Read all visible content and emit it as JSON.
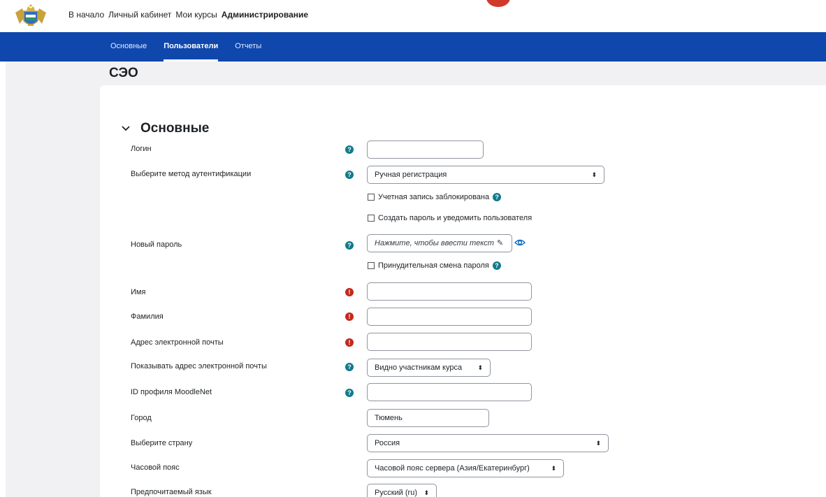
{
  "nav": {
    "home": "В начало",
    "dashboard": "Личный кабинет",
    "my_courses": "Мои курсы",
    "admin": "Администрирование"
  },
  "tabs": {
    "general": "Основные",
    "users": "Пользователи",
    "reports": "Отчеты"
  },
  "page": {
    "title": "СЭО"
  },
  "section": {
    "title": "Основные"
  },
  "form": {
    "username": {
      "label": "Логин",
      "value": ""
    },
    "auth": {
      "label": "Выберите метод аутентификации",
      "value": "Ручная регистрация"
    },
    "suspended": {
      "label": "Учетная запись заблокирована"
    },
    "create_password": {
      "label": "Создать пароль и уведомить пользователя"
    },
    "new_password": {
      "label": "Новый пароль",
      "placeholder": "Нажмите, чтобы ввести текст"
    },
    "force_change": {
      "label": "Принудительная смена пароля"
    },
    "firstname": {
      "label": "Имя",
      "value": ""
    },
    "lastname": {
      "label": "Фамилия",
      "value": ""
    },
    "email": {
      "label": "Адрес электронной почты",
      "value": ""
    },
    "email_display": {
      "label": "Показывать адрес электронной почты",
      "value": "Видно участникам курса"
    },
    "moodlenet": {
      "label": "ID профиля MoodleNet",
      "value": ""
    },
    "city": {
      "label": "Город",
      "value": "Тюмень"
    },
    "country": {
      "label": "Выберите страну",
      "value": "Россия"
    },
    "timezone": {
      "label": "Часовой пояс",
      "value": "Часовой пояс сервера (Азия/Екатеринбург)"
    },
    "lang": {
      "label": "Предпочитаемый язык",
      "value": "Русский (ru)"
    }
  },
  "icons": {
    "help": "?",
    "required": "!",
    "select_arrow": "⬍",
    "pencil": "✎"
  },
  "colors": {
    "brand_blue": "#0f47ad",
    "help_teal": "#117a8b",
    "required_red": "#c4281c"
  }
}
